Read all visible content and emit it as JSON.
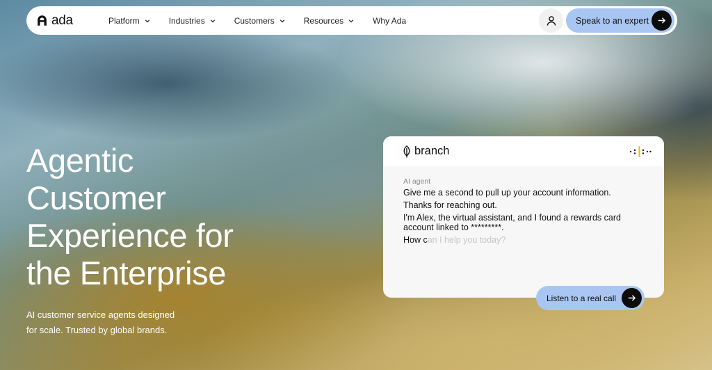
{
  "nav": {
    "logo_text": "ada",
    "items": [
      {
        "label": "Platform",
        "has_dropdown": true
      },
      {
        "label": "Industries",
        "has_dropdown": true
      },
      {
        "label": "Customers",
        "has_dropdown": true
      },
      {
        "label": "Resources",
        "has_dropdown": true
      },
      {
        "label": "Why Ada",
        "has_dropdown": false
      }
    ],
    "account_icon": "user-icon",
    "cta_label": "Speak to an expert",
    "cta_icon": "arrow-right-icon"
  },
  "hero": {
    "title_lines": [
      "Agentic",
      "Customer",
      "Experience for",
      "the Enterprise"
    ],
    "subtitle_lines": [
      "AI customer service agents designed",
      "for scale. Trusted by global brands."
    ]
  },
  "demo_card": {
    "brand_name": "branch",
    "brand_icon": "leaf-icon",
    "voice_icon": "audio-wave-icon",
    "speaker_label": "AI agent",
    "messages": [
      "Give me a second to pull up your account information.",
      "Thanks for reaching out.",
      "I'm Alex, the virtual assistant, and I found a rewards card account linked to *********."
    ],
    "typing_visible": "How c",
    "typing_faded": "an I help you today?",
    "listen_label": "Listen to a real call"
  },
  "colors": {
    "cta_bg": "#a9c6f2",
    "arrow_bg": "#0c0c0c",
    "wave_accent": "#f2b705"
  }
}
